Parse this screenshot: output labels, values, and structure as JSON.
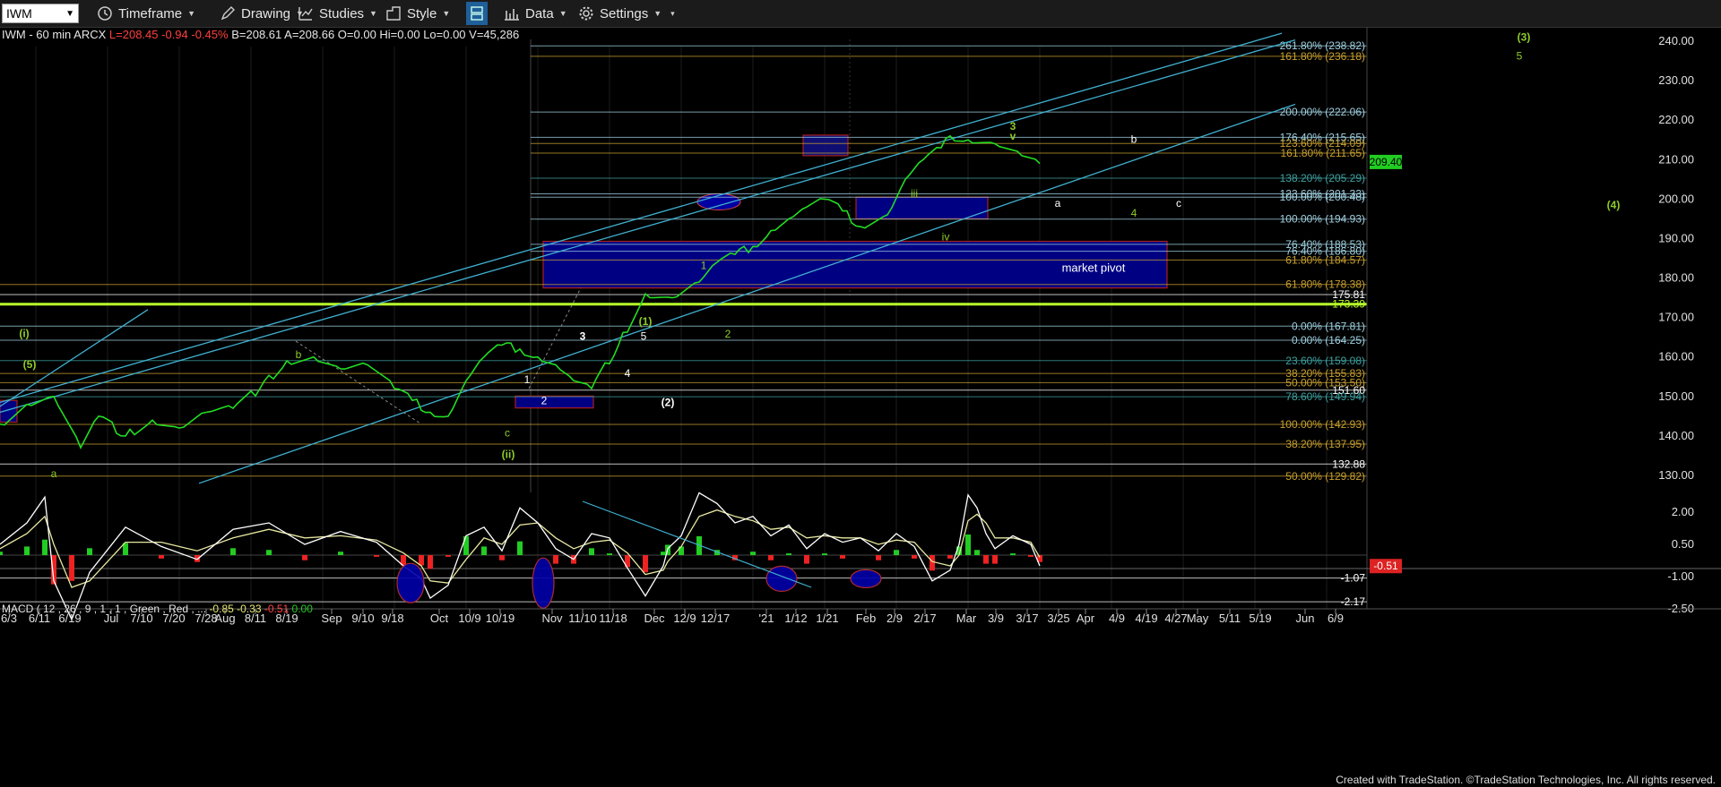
{
  "toolbar": {
    "symbol": "IWM",
    "items": [
      {
        "label": "Timeframe",
        "icon": "clock-icon"
      },
      {
        "label": "Drawing",
        "icon": "pencil-icon"
      },
      {
        "label": "Studies",
        "icon": "studies-icon"
      },
      {
        "label": "Style",
        "icon": "style-icon"
      },
      {
        "label": "",
        "icon": "panels-icon"
      },
      {
        "label": "Data",
        "icon": "bar-chart-icon"
      },
      {
        "label": "Settings",
        "icon": "gear-icon"
      }
    ]
  },
  "header": {
    "symbol_info": "IWM - 60 min  ARCX",
    "last": "L=208.45",
    "change": "-0.94",
    "change_pct": "-0.45%",
    "rest": "B=208.61  A=208.66  O=0.00  Hi=0.00  Lo=0.00  V=45,286"
  },
  "macd_header": {
    "label": "MACD ( 12 , 26 , 9 , 1 , 1 , Green , Red , ...",
    "v1": "-0.85",
    "v2": "-0.33",
    "v3": "-0.51",
    "v4": "0.00"
  },
  "footer": "Created with TradeStation. ©TradeStation Technologies, Inc. All rights reserved.",
  "colors": {
    "price": "#22dd22",
    "signal": "#e8e8a0",
    "macd_line": "#ffffff",
    "hist_pos": "#22cc22",
    "hist_neg": "#ee2222",
    "trend": "#40b0d0",
    "level_green": "#b8ff2a",
    "box": "#00008b",
    "box_border": "#b22222",
    "last_badge": "#22cc22"
  },
  "chart_data": {
    "type": "line",
    "price_axis": {
      "ylim": [
        125,
        243
      ],
      "ticks": [
        130,
        140,
        150,
        160,
        170,
        180,
        190,
        200,
        210,
        220,
        230,
        240
      ],
      "last": "209.40"
    },
    "x_ticks": [
      "6/3",
      "6/11",
      "6/19",
      "Jul",
      "7/10",
      "7/20",
      "7/28",
      "Aug",
      "8/11",
      "8/19",
      "Sep",
      "9/10",
      "9/18",
      "Oct",
      "10/9",
      "10/19",
      "Nov",
      "11/10",
      "11/18",
      "Dec",
      "12/9",
      "12/17",
      "'21",
      "1/12",
      "1/21",
      "Feb",
      "2/9",
      "2/17",
      "Mar",
      "3/9",
      "3/17",
      "3/25",
      "Apr",
      "4/9",
      "4/19",
      "4/27",
      "May",
      "5/11",
      "5/19",
      "Jun",
      "6/9"
    ],
    "price_series": {
      "name": "IWM",
      "x": [
        0,
        30,
        60,
        90,
        110,
        140,
        170,
        200,
        230,
        260,
        290,
        320,
        350,
        380,
        410,
        440,
        460,
        480,
        500,
        520,
        540,
        560,
        580,
        600,
        620,
        640,
        660,
        690,
        720,
        750,
        780,
        800,
        820,
        840,
        860,
        880,
        900,
        920,
        940,
        960,
        990,
        1010,
        1030,
        1050,
        1060,
        1080,
        1110,
        1140,
        1160
      ],
      "values": [
        143,
        148,
        150,
        137,
        145,
        140,
        144,
        142,
        146,
        147,
        152,
        159,
        160,
        157,
        158,
        152,
        149,
        146,
        145,
        154,
        160,
        163,
        162,
        160,
        158,
        154,
        152,
        163,
        176,
        175,
        179,
        184,
        186,
        188,
        192,
        195,
        198,
        200,
        197,
        193,
        196,
        205,
        210,
        213,
        216,
        215,
        214,
        211,
        209
      ]
    },
    "levels": [
      {
        "value": 238.82,
        "label": "261.80% (238.82)",
        "color": "#9fd0e0"
      },
      {
        "value": 236.18,
        "label": "161.80% (236.18)",
        "color": "#c8a030"
      },
      {
        "value": 222.06,
        "label": "200.00% (222.06)",
        "color": "#9fd0e0"
      },
      {
        "value": 215.65,
        "label": "176.40% (215.65)",
        "color": "#9fd0e0"
      },
      {
        "value": 214.09,
        "label": "123.60% (214.09)",
        "color": "#c8a030"
      },
      {
        "value": 211.65,
        "label": "161.80% (211.65)",
        "color": "#c8a030"
      },
      {
        "value": 205.29,
        "label": "138.20% (205.29)",
        "color": "#3fa0a0"
      },
      {
        "value": 201.33,
        "label": "123.60% (201.33)",
        "color": "#9fd0e0"
      },
      {
        "value": 200.48,
        "label": "100.00% (200.48)",
        "color": "#9fd0e0"
      },
      {
        "value": 194.93,
        "label": "100.00% (194.93)",
        "color": "#9fd0e0"
      },
      {
        "value": 188.53,
        "label": "76.40% (188.53)",
        "color": "#9fd0e0"
      },
      {
        "value": 186.8,
        "label": "76.40% (186.80)",
        "color": "#9fd0e0"
      },
      {
        "value": 184.57,
        "label": "61.80% (184.57)",
        "color": "#c8a030"
      },
      {
        "value": 178.38,
        "label": "61.80% (178.38)",
        "color": "#c8a030"
      },
      {
        "value": 175.81,
        "label": "175.81",
        "color": "#ffffff"
      },
      {
        "value": 173.39,
        "label": "173.39",
        "color": "#b8ff2a"
      },
      {
        "value": 167.81,
        "label": "0.00% (167.81)",
        "color": "#9fd0e0"
      },
      {
        "value": 164.25,
        "label": "0.00% (164.25)",
        "color": "#9fd0e0"
      },
      {
        "value": 159.08,
        "label": "23.60% (159.08)",
        "color": "#3fa0a0"
      },
      {
        "value": 155.83,
        "label": "38.20% (155.83)",
        "color": "#c8a030"
      },
      {
        "value": 153.5,
        "label": "50.00% (153.50)",
        "color": "#c8a030"
      },
      {
        "value": 151.6,
        "label": "151.60",
        "color": "#ffffff"
      },
      {
        "value": 149.94,
        "label": "78.60% (149.94)",
        "color": "#3fa0a0"
      },
      {
        "value": 142.93,
        "label": "100.00% (142.93)",
        "color": "#c8a030"
      },
      {
        "value": 137.95,
        "label": "38.20% (137.95)",
        "color": "#c8a030"
      },
      {
        "value": 132.88,
        "label": "132.88",
        "color": "#ffffff"
      },
      {
        "value": 129.82,
        "label": "50.00% (129.82)",
        "color": "#c8a030"
      }
    ],
    "annotations": [
      {
        "text": "market pivot",
        "x": 1220,
        "y": 182.5,
        "color": "#ffffff"
      },
      {
        "text": "(3)",
        "x": 1700,
        "y": 241,
        "color": "#8fcc2a"
      },
      {
        "text": "5",
        "x": 1695,
        "y": 236.3,
        "color": "#8fcc2a"
      },
      {
        "text": "3",
        "x": 1130,
        "y": 218.5,
        "color": "#8fcc2a"
      },
      {
        "text": "v",
        "x": 1130,
        "y": 216,
        "color": "#8fcc2a"
      },
      {
        "text": "b",
        "x": 1265,
        "y": 215.2,
        "color": "#ffffff"
      },
      {
        "text": "a",
        "x": 1180,
        "y": 199,
        "color": "#ffffff"
      },
      {
        "text": "c",
        "x": 1315,
        "y": 199,
        "color": "#ffffff"
      },
      {
        "text": "4",
        "x": 1265,
        "y": 196.5,
        "color": "#8fcc2a"
      },
      {
        "text": "(4)",
        "x": 1800,
        "y": 198.5,
        "color": "#8fcc2a"
      },
      {
        "text": "iii",
        "x": 1020,
        "y": 201.5,
        "color": "#8fcc2a"
      },
      {
        "text": "iv",
        "x": 1055,
        "y": 190.5,
        "color": "#8fcc2a"
      },
      {
        "text": "1",
        "x": 785,
        "y": 183.2,
        "color": "#8fcc2a"
      },
      {
        "text": "2",
        "x": 812,
        "y": 165.8,
        "color": "#8fcc2a"
      },
      {
        "text": "(1)",
        "x": 720,
        "y": 169,
        "color": "#8fcc2a"
      },
      {
        "text": "(2)",
        "x": 745,
        "y": 148.5,
        "color": "#ffffff"
      },
      {
        "text": "3",
        "x": 650,
        "y": 165.3,
        "color": "#ffffff"
      },
      {
        "text": "4",
        "x": 700,
        "y": 155.9,
        "color": "#ffffff"
      },
      {
        "text": "5",
        "x": 718,
        "y": 165.3,
        "color": "#ffffff"
      },
      {
        "text": "1",
        "x": 588,
        "y": 154.3,
        "color": "#ffffff"
      },
      {
        "text": "2",
        "x": 607,
        "y": 148.9,
        "color": "#ffffff"
      },
      {
        "text": "c",
        "x": 566,
        "y": 140.8,
        "color": "#8fcc2a"
      },
      {
        "text": "(ii)",
        "x": 567,
        "y": 135.3,
        "color": "#8fcc2a"
      },
      {
        "text": "b",
        "x": 333,
        "y": 160.6,
        "color": "#8fcc2a"
      },
      {
        "text": "(i)",
        "x": 27,
        "y": 166,
        "color": "#8fcc2a"
      },
      {
        "text": "(5)",
        "x": 33,
        "y": 158.1,
        "color": "#8fcc2a"
      },
      {
        "text": "a",
        "x": 60,
        "y": 130.5,
        "color": "#8fcc2a"
      }
    ],
    "macd": {
      "axis_ticks": [
        2.0,
        0.5,
        -1.0,
        -2.5
      ],
      "levels": [
        {
          "label": "-1.07",
          "value": -1.07
        },
        {
          "label": "-2.17",
          "value": -2.17
        }
      ],
      "last": "-0.51",
      "x": [
        0,
        30,
        50,
        60,
        80,
        100,
        140,
        180,
        220,
        260,
        300,
        340,
        380,
        420,
        450,
        470,
        480,
        500,
        520,
        540,
        560,
        580,
        600,
        620,
        640,
        660,
        680,
        700,
        720,
        740,
        745,
        760,
        780,
        800,
        820,
        840,
        860,
        880,
        900,
        920,
        940,
        960,
        980,
        1000,
        1020,
        1040,
        1060,
        1070,
        1080,
        1090,
        1100,
        1110,
        1130,
        1150,
        1160
      ],
      "macd_line": [
        0.5,
        1.5,
        2.7,
        -1.2,
        -3.0,
        -0.8,
        1.3,
        0.4,
        -0.2,
        1.2,
        1.5,
        0.5,
        1.1,
        0.6,
        -0.5,
        -1.1,
        -2.0,
        -1.4,
        0.9,
        1.3,
        0.2,
        2.2,
        1.5,
        0.3,
        -0.2,
        1.0,
        0.8,
        -0.6,
        -1.9,
        -0.5,
        0.3,
        0.9,
        2.9,
        2.4,
        1.5,
        1.8,
        0.9,
        1.4,
        0.3,
        1.0,
        0.6,
        0.8,
        0.2,
        1.0,
        0.4,
        -1.2,
        -0.7,
        0.5,
        2.8,
        2.2,
        1.0,
        0.3,
        0.9,
        0.5,
        -0.5
      ],
      "signal_line": [
        0.3,
        1.0,
        1.8,
        0.5,
        -1.5,
        -1.2,
        0.6,
        0.6,
        0.2,
        0.8,
        1.2,
        0.8,
        0.9,
        0.7,
        0.1,
        -0.5,
        -1.2,
        -1.3,
        -0.2,
        0.8,
        0.5,
        1.4,
        1.5,
        0.8,
        0.3,
        0.6,
        0.7,
        0.1,
        -0.9,
        -0.7,
        -0.3,
        0.4,
        1.8,
        2.1,
        1.8,
        1.6,
        1.2,
        1.3,
        0.8,
        0.9,
        0.8,
        0.8,
        0.5,
        0.7,
        0.6,
        -0.3,
        -0.5,
        0.0,
        1.6,
        1.9,
        1.5,
        0.8,
        0.8,
        0.6,
        -0.1
      ]
    }
  }
}
